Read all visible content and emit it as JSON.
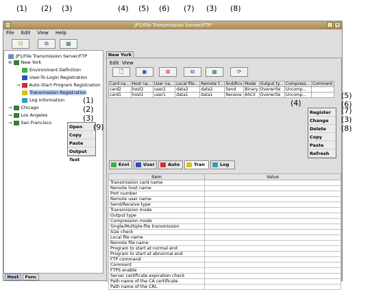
{
  "window": {
    "title": "JP1/File Transmission Server/FTP"
  },
  "menu": {
    "file": "File",
    "edit": "Edit",
    "view": "View",
    "help": "Help"
  },
  "callouts": {
    "c1": "(1)",
    "c2": "(2)",
    "c3": "(3)",
    "c4": "(4)",
    "c5": "(5)",
    "c6": "(6)",
    "c7": "(7)",
    "c8": "(8)",
    "c9": "(9)"
  },
  "tree": {
    "root": "JP1/File Transmission Server/FTP",
    "host1": "New York",
    "items": [
      "Environment Definition",
      "User-To-Login Registration",
      "Auto-Start Program Registration",
      "Transmission Registration",
      "Log Information"
    ],
    "host2": "Chicago",
    "host3": "Los Angeles",
    "host4": "San Francisco"
  },
  "tree_menu": {
    "open": "Open",
    "copy": "Copy",
    "paste": "Paste",
    "output_text": "Output Text"
  },
  "right": {
    "tab": "New York",
    "menu_edit": "Edit",
    "menu_view": "View"
  },
  "table": {
    "headers": [
      "Card na...",
      "Host na...",
      "User na...",
      "Local file...",
      "Remote f...",
      "Snd/Rcv",
      "Mode",
      "Output ty...",
      "Compress...",
      "Comment"
    ],
    "rows": [
      [
        "card2",
        "host2",
        "user2",
        "data2",
        "data2",
        "Send",
        "Binary",
        "Overwrite",
        "Uncomp...",
        ""
      ],
      [
        "card1",
        "host1",
        "user1",
        "data1",
        "data1",
        "Receive",
        "ASCII",
        "Overwrite",
        "Uncomp...",
        ""
      ]
    ]
  },
  "table_menu": {
    "register": "Register",
    "change": "Change",
    "delete": "Delete",
    "copy": "Copy",
    "paste": "Paste",
    "refresh": "Refresh"
  },
  "tabs2": [
    "Envi",
    "User",
    "Auto",
    "Tran",
    "Log"
  ],
  "props": {
    "header_item": "Item",
    "header_value": "Value",
    "items": [
      "Transmission card name",
      "Remote host name",
      "Port number",
      "Remote user name",
      "Send/Receive type",
      "Transmission mode",
      "Output type",
      "Compression mode",
      "Single/Multiple-file transmission",
      "Size check",
      "Local file name",
      "Remote file name",
      "Program to start at normal end",
      "Program to start at abnormal end",
      "FTP command",
      "Comment",
      "FTPS enable",
      "Server certificate expiration check",
      "Path name of the CA certificate",
      "Path name of the CRL"
    ]
  },
  "bottom_tabs": {
    "host": "Host",
    "func": "Func"
  }
}
